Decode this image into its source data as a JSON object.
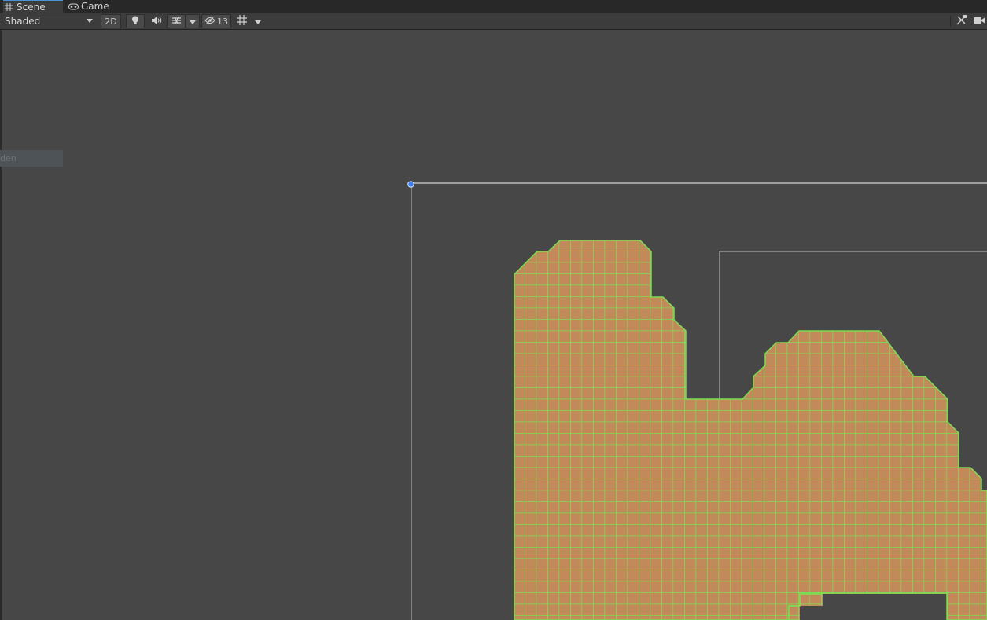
{
  "tabs": [
    {
      "label": "Scene",
      "icon": "scene-grid-icon",
      "active": true
    },
    {
      "label": "Game",
      "icon": "gamepad-icon",
      "active": false
    }
  ],
  "toolbar": {
    "shading_mode": "Shaded",
    "mode_2d": "2D",
    "hidden_count": "13"
  },
  "hierarchy_label": "den",
  "colors": {
    "scene_bg": "#474747",
    "tile_fill": "#c28a5a",
    "tile_grid": "#7fdc52",
    "bounds": "#bdbdbd",
    "pivot": "#3b82f6"
  }
}
